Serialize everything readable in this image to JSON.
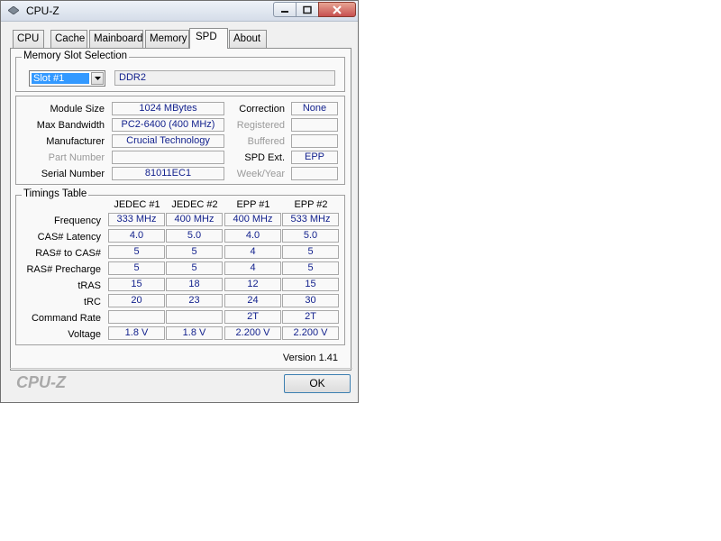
{
  "window": {
    "title": "CPU-Z"
  },
  "tabs": [
    {
      "label": "CPU"
    },
    {
      "label": "Cache"
    },
    {
      "label": "Mainboard"
    },
    {
      "label": "Memory"
    },
    {
      "label": "SPD"
    },
    {
      "label": "About"
    }
  ],
  "active_tab": "SPD",
  "slot_selection": {
    "group_label": "Memory Slot Selection",
    "selected_slot": "Slot #1",
    "memory_type": "DDR2"
  },
  "module_info": {
    "module_size": {
      "label": "Module Size",
      "value": "1024 MBytes"
    },
    "max_bandwidth": {
      "label": "Max Bandwidth",
      "value": "PC2-6400 (400 MHz)"
    },
    "manufacturer": {
      "label": "Manufacturer",
      "value": "Crucial Technology"
    },
    "part_number": {
      "label": "Part Number",
      "value": ""
    },
    "serial_number": {
      "label": "Serial Number",
      "value": "81011EC1"
    },
    "correction": {
      "label": "Correction",
      "value": "None"
    },
    "registered": {
      "label": "Registered",
      "value": ""
    },
    "buffered": {
      "label": "Buffered",
      "value": ""
    },
    "spd_ext": {
      "label": "SPD Ext.",
      "value": "EPP"
    },
    "week_year": {
      "label": "Week/Year",
      "value": ""
    }
  },
  "timings": {
    "group_label": "Timings Table",
    "columns": [
      "JEDEC #1",
      "JEDEC #2",
      "EPP #1",
      "EPP #2"
    ],
    "rows": [
      {
        "label": "Frequency",
        "values": [
          "333 MHz",
          "400 MHz",
          "400 MHz",
          "533 MHz"
        ]
      },
      {
        "label": "CAS# Latency",
        "values": [
          "4.0",
          "5.0",
          "4.0",
          "5.0"
        ]
      },
      {
        "label": "RAS# to CAS#",
        "values": [
          "5",
          "5",
          "4",
          "5"
        ]
      },
      {
        "label": "RAS# Precharge",
        "values": [
          "5",
          "5",
          "4",
          "5"
        ]
      },
      {
        "label": "tRAS",
        "values": [
          "15",
          "18",
          "12",
          "15"
        ]
      },
      {
        "label": "tRC",
        "values": [
          "20",
          "23",
          "24",
          "30"
        ]
      },
      {
        "label": "Command Rate",
        "values": [
          "",
          "",
          "2T",
          "2T"
        ]
      },
      {
        "label": "Voltage",
        "values": [
          "1.8 V",
          "1.8 V",
          "2.200 V",
          "2.200 V"
        ]
      }
    ]
  },
  "footer": {
    "version": "Version 1.41",
    "brand": "CPU-Z",
    "ok_label": "OK"
  },
  "colors": {
    "value_text": "#101f8c",
    "close_button": "#c75050",
    "selection": "#3399ff"
  }
}
